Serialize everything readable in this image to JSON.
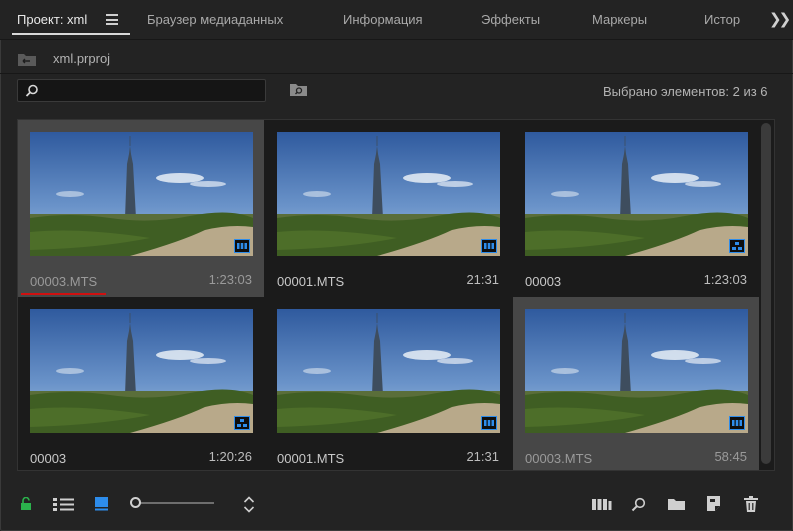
{
  "tabs": [
    {
      "label": "Проект: xml",
      "active": true
    },
    {
      "label": "Браузер медиаданных"
    },
    {
      "label": "Информация"
    },
    {
      "label": "Эффекты"
    },
    {
      "label": "Маркеры"
    },
    {
      "label": "Истор"
    }
  ],
  "project": {
    "file": "xml.prproj"
  },
  "search": {
    "value": "",
    "placeholder": ""
  },
  "selection": {
    "status": "Выбрано элементов: 2 из 6"
  },
  "items": [
    {
      "name": "00003.MTS",
      "duration": "1:23:03",
      "selected": true,
      "badge": "clip-icon",
      "name_underlined": true
    },
    {
      "name": "00001.MTS",
      "duration": "21:31",
      "selected": false,
      "badge": "clip-icon"
    },
    {
      "name": "00003",
      "duration": "1:23:03",
      "selected": false,
      "badge": "sequence-icon"
    },
    {
      "name": "00003",
      "duration": "1:20:26",
      "selected": false,
      "badge": "sequence-icon"
    },
    {
      "name": "00001.MTS",
      "duration": "21:31",
      "selected": false,
      "badge": "clip-icon"
    },
    {
      "name": "00003.MTS",
      "duration": "58:45",
      "selected": true,
      "badge": "clip-icon",
      "name_underlined": true
    }
  ],
  "colors": {
    "accent_blue": "#2d8ceb",
    "lock_green": "#2bb24c",
    "annotation_red": "#d01010"
  },
  "footer_icons": [
    "lock-open-icon",
    "list-view-icon",
    "icon-view-icon",
    "zoom-slider",
    "sort-icon",
    "automate-to-sequence-icon",
    "find-icon",
    "new-bin-icon",
    "new-item-icon",
    "trash-icon"
  ]
}
